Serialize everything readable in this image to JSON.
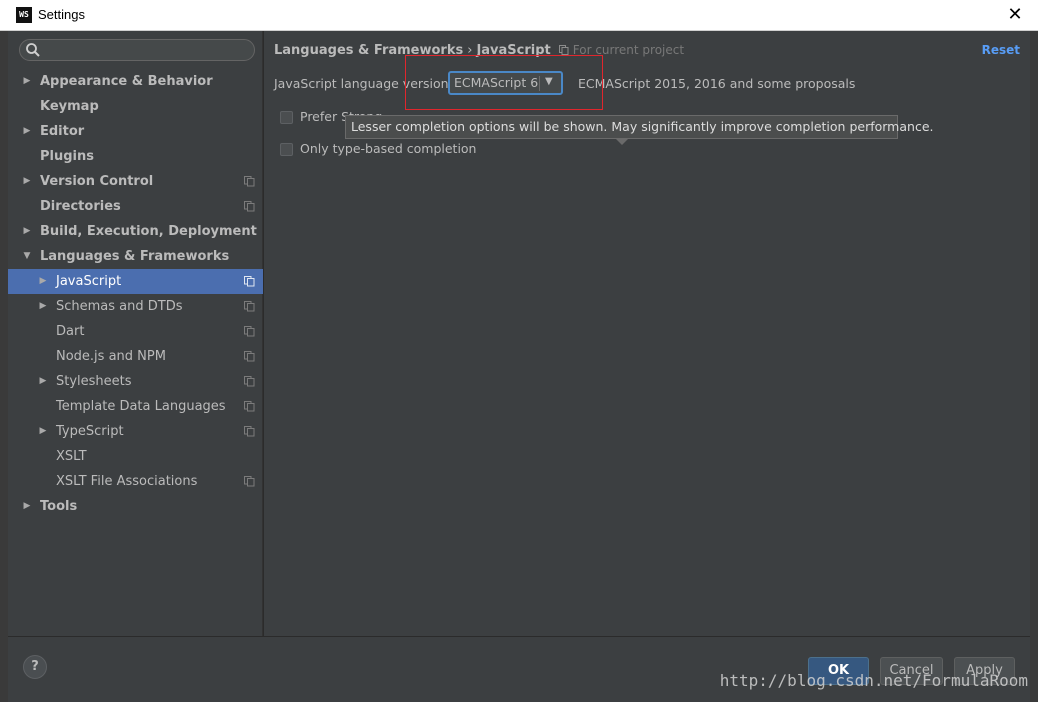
{
  "window": {
    "app_icon": "WS",
    "title": "Settings",
    "close_glyph": "✕"
  },
  "search": {
    "placeholder": "",
    "value": ""
  },
  "tree": [
    {
      "label": "Appearance & Behavior",
      "level": 0,
      "arrow": "▶",
      "copy": false,
      "selected": false
    },
    {
      "label": "Keymap",
      "level": 0,
      "arrow": "",
      "copy": false,
      "selected": false
    },
    {
      "label": "Editor",
      "level": 0,
      "arrow": "▶",
      "copy": false,
      "selected": false
    },
    {
      "label": "Plugins",
      "level": 0,
      "arrow": "",
      "copy": false,
      "selected": false
    },
    {
      "label": "Version Control",
      "level": 0,
      "arrow": "▶",
      "copy": true,
      "selected": false
    },
    {
      "label": "Directories",
      "level": 0,
      "arrow": "",
      "copy": true,
      "selected": false
    },
    {
      "label": "Build, Execution, Deployment",
      "level": 0,
      "arrow": "▶",
      "copy": false,
      "selected": false
    },
    {
      "label": "Languages & Frameworks",
      "level": 0,
      "arrow": "▼",
      "copy": false,
      "selected": false
    },
    {
      "label": "JavaScript",
      "level": 1,
      "arrow": "▶",
      "copy": true,
      "selected": true
    },
    {
      "label": "Schemas and DTDs",
      "level": 1,
      "arrow": "▶",
      "copy": true,
      "selected": false
    },
    {
      "label": "Dart",
      "level": 1,
      "arrow": "",
      "copy": true,
      "selected": false
    },
    {
      "label": "Node.js and NPM",
      "level": 1,
      "arrow": "",
      "copy": true,
      "selected": false
    },
    {
      "label": "Stylesheets",
      "level": 1,
      "arrow": "▶",
      "copy": true,
      "selected": false
    },
    {
      "label": "Template Data Languages",
      "level": 1,
      "arrow": "",
      "copy": true,
      "selected": false
    },
    {
      "label": "TypeScript",
      "level": 1,
      "arrow": "▶",
      "copy": true,
      "selected": false
    },
    {
      "label": "XSLT",
      "level": 1,
      "arrow": "",
      "copy": false,
      "selected": false
    },
    {
      "label": "XSLT File Associations",
      "level": 1,
      "arrow": "",
      "copy": true,
      "selected": false
    },
    {
      "label": "Tools",
      "level": 0,
      "arrow": "▶",
      "copy": false,
      "selected": false
    }
  ],
  "breadcrumb": {
    "parent": "Languages & Frameworks",
    "separator": "›",
    "current": "JavaScript",
    "scope": "For current project"
  },
  "reset_label": "Reset",
  "language": {
    "label": "JavaScript language version",
    "selected": "ECMAScript 6",
    "description": "ECMAScript 2015, 2016 and some proposals"
  },
  "options": {
    "prefer_label": "Prefer Strong",
    "prefer_checked": false,
    "type_based_label": "Only type-based completion",
    "type_based_checked": false
  },
  "tooltip": "Lesser completion options will be shown. May significantly improve completion performance.",
  "footer": {
    "help": "?",
    "ok": "OK",
    "cancel": "Cancel",
    "apply": "Apply"
  },
  "watermark": "http://blog.csdn.net/FormulaRoom",
  "colors": {
    "accent": "#4b6eaf",
    "link": "#589df6",
    "highlight_box": "#e0262d"
  }
}
